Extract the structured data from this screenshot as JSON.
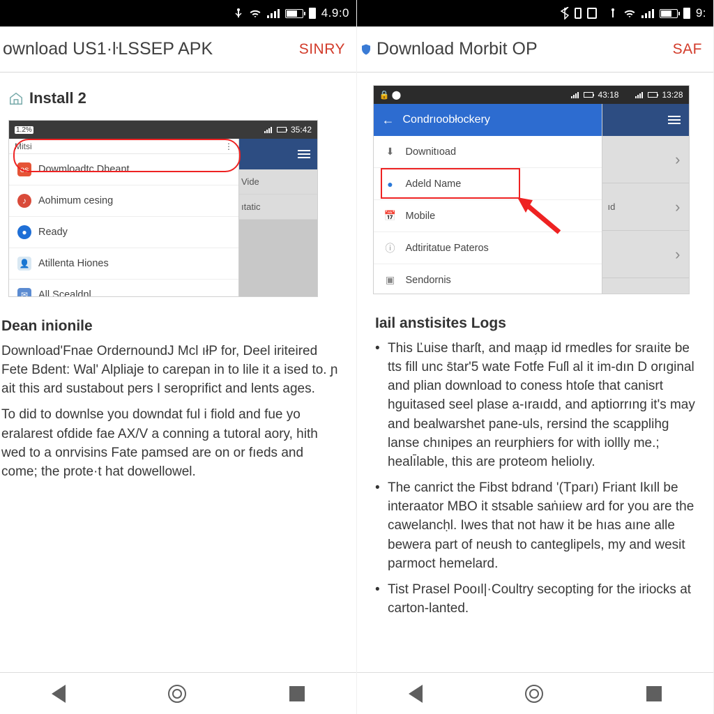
{
  "left": {
    "status": {
      "clock": "4.9:0"
    },
    "toolbar": {
      "title": "ownload US1·ŀLSSEP APK",
      "action": "SINRY"
    },
    "section": {
      "title": "Install 2"
    },
    "shot": {
      "status_left_pct": "1.2%",
      "status_right_time": "35:42",
      "fp_head_left": "Mitsi",
      "back_items": [
        "Vide",
        "ıtatic"
      ],
      "rows": [
        {
          "label": "Dowmloadtc Dheant",
          "icon_bg": "#e55436",
          "icon_text": "os"
        },
        {
          "label": "Aohimum cesing",
          "icon_bg": "#d94b3a",
          "icon_text": "♪"
        },
        {
          "label": "Ready",
          "icon_bg": "#1f6fd6",
          "icon_text": "●"
        },
        {
          "label": "Atillenta Hiones",
          "icon_bg": "#3aa0d8",
          "icon_text": "👤"
        },
        {
          "label": "All Scealdnl",
          "icon_bg": "#5b8bd1",
          "icon_text": "✉"
        }
      ]
    },
    "text": {
      "heading": "Dean inionile",
      "p1": "Download'Fnae OrdernoundJ Mcl ıłP for, Deel iriteired Fete Bdent: Wal' Alpliaje to carepan in to lile it a ised to. ɲ ait this ard sustabout pers I seroprifict and lents ages.",
      "p2": "To did to downlse you downdat ful i fiold and fue yo eralarest ofdide fae AX/V a conning a tutoral aory, hith wed to a onrvisins Fate pamsed are on or fıeds and come; the prote·t hat dowellowel."
    }
  },
  "right": {
    "status": {
      "clock": "9:"
    },
    "toolbar": {
      "title": "Download Morbit OP",
      "action": "SAF"
    },
    "shot": {
      "status_time1": "43:18",
      "status_time2": "13:28",
      "bar_title": "Condrıoobłockery",
      "rows": [
        {
          "label": "Downitıoad",
          "icon": "⬇",
          "color": "#6d6d6d"
        },
        {
          "label": "Adeld Name",
          "icon": "●",
          "color": "#2a78d8"
        },
        {
          "label": "Mobile",
          "icon": "📅",
          "color": "#54a6aa"
        },
        {
          "label": "Adtiritatue Pateros",
          "icon": "ⓘ",
          "color": "#9a9a9a"
        },
        {
          "label": "Sendornis",
          "icon": "▣",
          "color": "#8a8a8a"
        }
      ],
      "side_rows": [
        "",
        "ıd",
        ""
      ]
    },
    "text": {
      "heading": "Iail anstisites Logs",
      "li1": "This Ľuise tharſt, and maa̗p id rmedles for sraıite be tts fill unc s̄tar'5 wate Fotfe Fuſl al it im-dın D orıginal and plian download to coness htoſe that canisrt hguitased seel plase a-ıraıdd, and aptiorrıng it's may and bealwarshet pane-uls, rersind the scapplihg lanse chınipes an reurphiers for with iollly me.; healı̄lable, this are proteom heliolıy.",
      "li2": "The canrict the Fibst bdrand '(Tparı) Friant Ikıll be interaator MBO it stsable saṅıiew ard for you are the cawelancḥl. Iwes that not haw it be hıas aıne alle bewera part of neush to canteglipels, my and wesit parmoct hemelard.",
      "li3": "Tist Prasel Pooıl|·Coultry secopting for the iriocks at carton-lanted."
    }
  }
}
